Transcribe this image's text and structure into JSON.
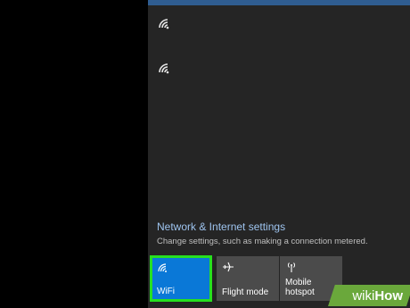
{
  "network_list": {
    "items": [
      {
        "icon": "wifi-signal-icon"
      },
      {
        "icon": "wifi-signal-icon"
      }
    ]
  },
  "settings": {
    "link_label": "Network & Internet settings",
    "description": "Change settings, such as making a connection metered."
  },
  "quick_actions": {
    "wifi_label": "WiFi",
    "flight_label": "Flight mode",
    "hotspot_label_line1": "Mobile",
    "hotspot_label_line2": "hotspot"
  },
  "watermark": {
    "brand_first": "wiki",
    "brand_second": "How"
  },
  "colors": {
    "panel_bg": "#252525",
    "tile_active": "#0a78d7",
    "tile_inactive": "#4b4b4b",
    "highlight_border": "#27e01f",
    "link_color": "#9ec4ef"
  }
}
